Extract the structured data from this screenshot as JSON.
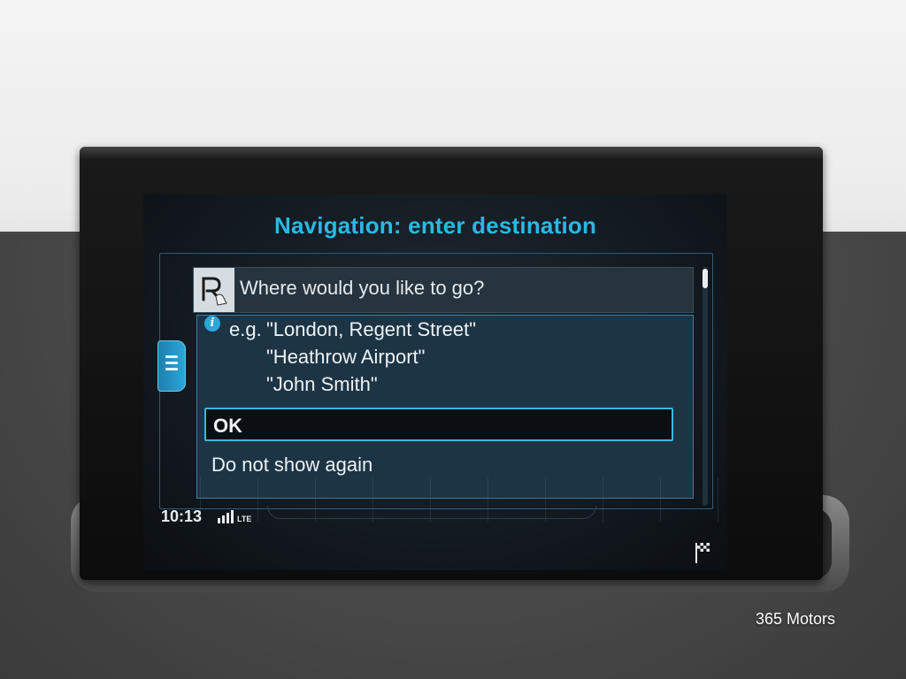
{
  "screen": {
    "title": "Navigation: enter destination",
    "search": {
      "placeholder": "Where would you like to go?",
      "icon": "handwriting-input-icon"
    },
    "info": {
      "icon": "info-icon",
      "prefix": "e.g.",
      "examples": [
        "\"London, Regent Street\"",
        "\"Heathrow Airport\"",
        "\"John Smith\""
      ]
    },
    "buttons": {
      "ok": "OK",
      "do_not_show": "Do not show again"
    },
    "status": {
      "time": "10:13",
      "network": "LTE"
    },
    "colors": {
      "accent": "#29b8e6",
      "selection_border": "#36b8e8"
    }
  },
  "watermark": "365 Motors"
}
